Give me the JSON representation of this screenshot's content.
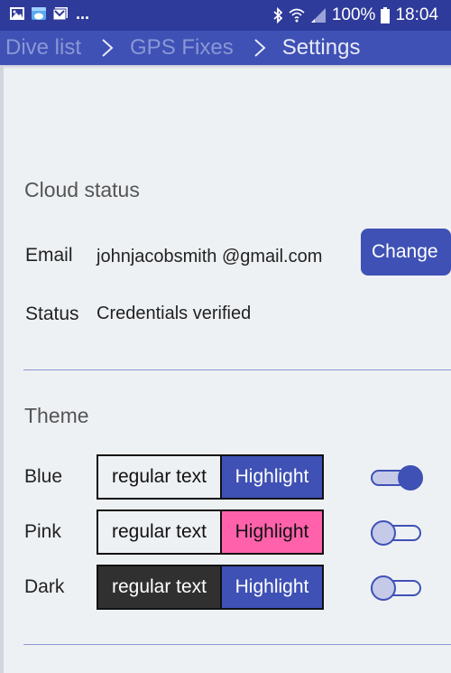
{
  "status_bar": {
    "notification_icons": [
      "gallery-icon",
      "es-file-explorer-icon",
      "gmail-icon"
    ],
    "overflow": "...",
    "system_icons": [
      "bluetooth-icon",
      "wifi-icon",
      "signal-icon"
    ],
    "battery": "100%",
    "time": "18:04"
  },
  "breadcrumb": [
    {
      "label": "Dive list"
    },
    {
      "label": "GPS Fixes"
    },
    {
      "label": "Settings"
    }
  ],
  "cloud_status": {
    "title": "Cloud status",
    "email_label": "Email",
    "email_value": "johnjacobsmith @gmail.com",
    "change_button": "Change",
    "status_label": "Status",
    "status_value": "Credentials verified"
  },
  "theme": {
    "title": "Theme",
    "items": [
      {
        "name": "Blue",
        "regular": "regular text",
        "highlight": "Highlight",
        "regular_bg": "#eef1f4",
        "regular_fg": "#111111",
        "highlight_bg": "#3f51b5",
        "highlight_fg": "#ffffff",
        "selected": true
      },
      {
        "name": "Pink",
        "regular": "regular text",
        "highlight": "Highlight",
        "regular_bg": "#eef1f4",
        "regular_fg": "#111111",
        "highlight_bg": "#ff62ab",
        "highlight_fg": "#111111",
        "selected": false
      },
      {
        "name": "Dark",
        "regular": "regular text",
        "highlight": "Highlight",
        "regular_bg": "#303030",
        "regular_fg": "#ffffff",
        "highlight_bg": "#3f51b5",
        "highlight_fg": "#ffffff",
        "selected": false
      }
    ]
  },
  "colors": {
    "primary": "#3f51b5",
    "primary_dark": "#2f3b9a",
    "toggle_light": "#c5cae9",
    "background": "#eef1f4"
  }
}
